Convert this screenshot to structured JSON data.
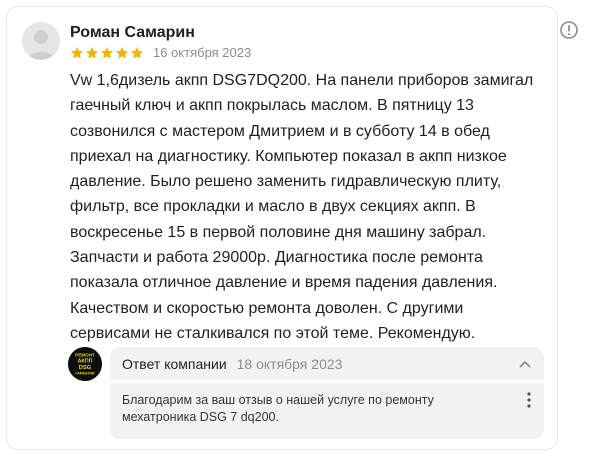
{
  "review": {
    "author": "Роман Самарин",
    "rating": 5,
    "date": "16 октября 2023",
    "text": "Vw 1,6дизель акпп DSG7DQ200. На панели приборов замигал\nгаечный ключ и акпп покрылась маслом. В пятницу 13\nсозвонился с мастером Дмитрием и в субботу 14 в обед\nприехал на диагностику. Компьютер показал в акпп низкое\nдавление. Было решено заменить гидравлическую плиту,\nфильтр, все прокладки и масло в двух секциях акпп. В\nвоскресенье 15 в первой половине дня машину забрал.\nЗапчасти и работа 29000р. Диагностика после ремонта\nпоказала отличное давление и время падения давления.\nКачеством и скоростью ремонта доволен. С другими\nсервисами не сталкивался по этой теме. Рекомендую."
  },
  "company_reply": {
    "logo_text": [
      "РЕМОНТ",
      "АКПП",
      "DSG",
      "ГАРАНТИЯ"
    ],
    "title": "Ответ компании",
    "date": "18 октября 2023",
    "text": "Благодарим за ваш отзыв о нашей услуге по ремонту\nмехатроника DSG 7 dq200."
  },
  "icons": {
    "info": "info-circle-icon",
    "chevron": "chevron-up-icon",
    "more": "more-vertical-icon",
    "star": "star-icon"
  },
  "colors": {
    "star": "#f5b400",
    "muted": "#8c8c8c",
    "reply_bg": "#f2f2f2"
  }
}
